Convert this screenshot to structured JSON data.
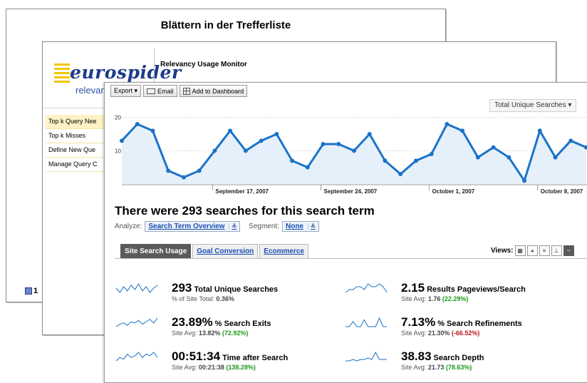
{
  "slide": {
    "title": "Blättern in der Trefferliste",
    "footer_label": "1"
  },
  "app": {
    "logo_main": "eurospider",
    "logo_sub": "relevanc",
    "title": "Relevancy Usage Monitor",
    "menu": [
      {
        "label": "Top k Query Nee",
        "active": true
      },
      {
        "label": "Top k Misses",
        "active": false
      },
      {
        "label": "Define New Que",
        "active": false
      },
      {
        "label": "Manage Query C",
        "active": false
      }
    ]
  },
  "toolbar": {
    "export": "Export ▾",
    "email": "Email",
    "dashboard": "Add to Dashboard"
  },
  "metric_select": "Total Unique Searches ▾",
  "chart_data": {
    "type": "area",
    "series": [
      {
        "values": [
          13,
          18,
          16,
          4,
          2,
          4,
          10,
          16,
          10,
          13,
          15,
          7,
          5,
          12,
          12,
          10,
          15,
          7,
          3,
          7,
          9,
          18,
          16,
          8,
          11,
          8,
          1,
          16,
          8,
          13,
          11
        ]
      }
    ],
    "yticks": [
      {
        "label": "20",
        "value": 20
      },
      {
        "label": "10",
        "value": 10
      }
    ],
    "right_tick": "2",
    "ylim": [
      0,
      21
    ],
    "xlabels": [
      "September 17, 2007",
      "September 24, 2007",
      "October 1, 2007",
      "October 8, 2007"
    ],
    "grid": true,
    "color": "#1a73c8",
    "fill": "#e6f0fa"
  },
  "headline": "There were 293 searches for this search term",
  "analyze": {
    "label": "Analyze:",
    "value": "Search Term Overview",
    "segment_label": "Segment:",
    "segment_value": "None",
    "dropdown": "≚"
  },
  "tabs": [
    "Site Search Usage",
    "Goal Conversion",
    "Ecommerce"
  ],
  "views_label": "Views:",
  "stats": [
    {
      "value": "293",
      "label": "Total Unique Searches",
      "sub_prefix": "% of Site Total: ",
      "sub_value": "0.36%",
      "sub_tone": "plain",
      "sub_suffix": "",
      "spark": [
        5,
        2,
        6,
        3,
        7,
        4,
        8,
        3,
        6,
        2,
        5,
        7
      ]
    },
    {
      "value": "2.15",
      "label": "Results Pageviews/Search",
      "sub_prefix": "Site Avg: ",
      "sub_value": "1.76",
      "sub_tone": "plain",
      "sub_suffix": "(22.29%)",
      "spark": [
        4,
        5,
        5,
        6,
        6,
        5,
        7,
        6,
        6,
        7,
        6,
        4
      ]
    },
    {
      "value": "23.89%",
      "label": "% Search Exits",
      "sub_prefix": "Site Avg: ",
      "sub_value": "13.82%",
      "sub_tone": "plain",
      "sub_suffix": "(72.92%)",
      "spark": [
        2,
        4,
        5,
        3,
        6,
        5,
        7,
        4,
        6,
        8,
        5,
        9
      ]
    },
    {
      "value": "7.13%",
      "label": "% Search Refinements",
      "sub_prefix": "Site Avg: ",
      "sub_value": "21.30%",
      "sub_tone": "plain",
      "sub_suffix": "(-66.52%)",
      "spark": [
        3,
        3,
        6,
        3,
        3,
        7,
        3,
        3,
        3,
        8,
        3,
        3
      ]
    },
    {
      "value": "00:51:34",
      "label": "Time after Search",
      "sub_prefix": "Site Avg: ",
      "sub_value": "00:21:38",
      "sub_tone": "plain",
      "sub_suffix": "(138.28%)",
      "spark": [
        2,
        4,
        3,
        6,
        4,
        5,
        7,
        4,
        6,
        5,
        7,
        4
      ]
    },
    {
      "value": "38.83",
      "label": "Search Depth",
      "sub_prefix": "Site Avg: ",
      "sub_value": "21.73",
      "sub_tone": "plain",
      "sub_suffix": "(78.63%)",
      "spark": [
        2,
        2,
        3,
        2,
        3,
        3,
        4,
        3,
        8,
        3,
        3,
        3
      ]
    }
  ],
  "colors": {
    "positive": "#1a9a1a",
    "negative": "#c01818",
    "link": "#1a4fb0"
  }
}
